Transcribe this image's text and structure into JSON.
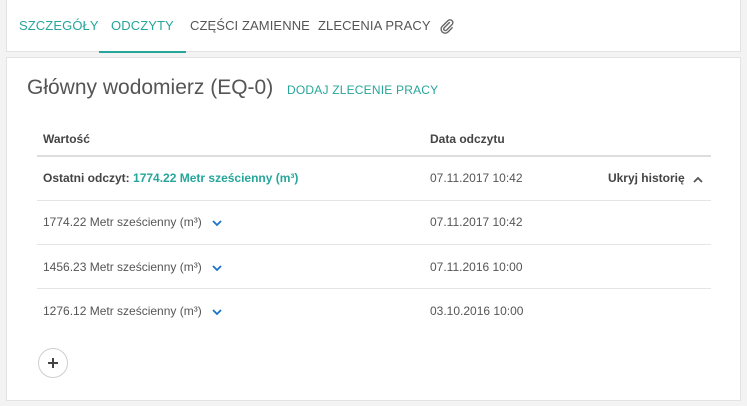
{
  "tabs": [
    {
      "label": "SZCZEGÓŁY"
    },
    {
      "label": "ODCZYTY"
    },
    {
      "label": "CZĘŚCI ZAMIENNE"
    },
    {
      "label": "ZLECENIA PRACY"
    }
  ],
  "attachment_icon": "paperclip-icon",
  "page": {
    "title": "Główny wodomierz (EQ-0)",
    "add_order_label": "DODAJ ZLECENIE PRACY"
  },
  "table": {
    "headers": [
      "Wartość",
      "Data odczytu"
    ],
    "latest": {
      "label": "Ostatni odczyt:",
      "value": "1774.22 Metr sześcienny (m³)",
      "date": "07.11.2017 10:42",
      "toggle_label": "Ukryj historię"
    },
    "rows": [
      {
        "value": "1774.22 Metr sześcienny (m³)",
        "date": "07.11.2017 10:42"
      },
      {
        "value": "1456.23 Metr sześcienny (m³)",
        "date": "07.11.2016 10:00"
      },
      {
        "value": "1276.12 Metr sześcienny (m³)",
        "date": "03.10.2016 10:00"
      }
    ]
  },
  "add_button_icon": "plus-icon",
  "colors": {
    "accent": "#26a69a",
    "text": "#555555",
    "background": "#f3f3f3"
  }
}
